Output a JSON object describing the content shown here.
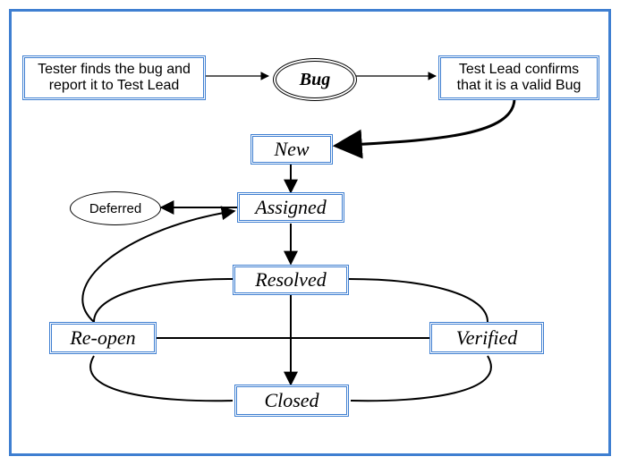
{
  "nodes": {
    "tester_box": "Tester finds  the bug and report it to Test Lead",
    "bug": "Bug",
    "lead_box": "Test Lead  confirms that it is a valid Bug",
    "new": "New",
    "assigned": "Assigned",
    "deferred": "Deferred",
    "resolved": "Resolved",
    "reopen": "Re-open",
    "verified": "Verified",
    "closed": "Closed"
  },
  "edges": [
    [
      "tester_box",
      "bug"
    ],
    [
      "bug",
      "lead_box"
    ],
    [
      "lead_box",
      "new"
    ],
    [
      "new",
      "assigned"
    ],
    [
      "assigned",
      "deferred"
    ],
    [
      "assigned",
      "resolved"
    ],
    [
      "resolved",
      "reopen"
    ],
    [
      "resolved",
      "verified"
    ],
    [
      "resolved",
      "closed"
    ],
    [
      "reopen",
      "assigned"
    ],
    [
      "verified",
      "closed"
    ],
    [
      "reopen",
      "closed"
    ]
  ]
}
